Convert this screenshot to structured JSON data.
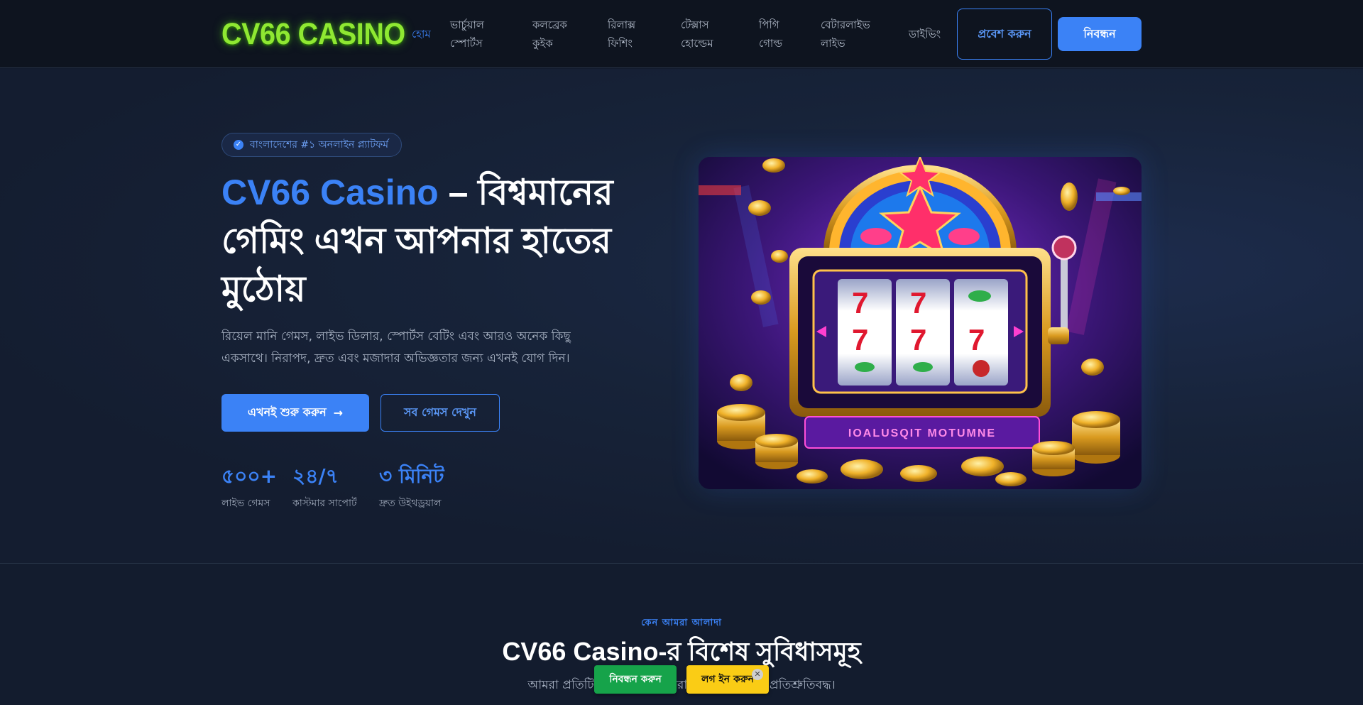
{
  "header": {
    "logo": "CV66 CASINO",
    "nav": [
      {
        "label": "হোম",
        "active": true
      },
      {
        "label": "ভার্চুয়াল\nস্পোর্টস"
      },
      {
        "label": "কলব্রেক\nকুইক"
      },
      {
        "label": "রিলাক্স\nফিশিং"
      },
      {
        "label": "টেক্সাস\nহোল্ডেম"
      },
      {
        "label": "পিগি\nগোল্ড"
      },
      {
        "label": "বেটারলাইভ\nলাইভ"
      },
      {
        "label": "ডাইভিং"
      }
    ],
    "login_label": "প্রবেশ করুন",
    "register_label": "নিবন্ধন"
  },
  "hero": {
    "badge": "বাংলাদেশের #১ অনলাইন প্ল্যাটফর্ম",
    "title_brand": "CV66 Casino",
    "title_rest": " – বিশ্বমানের গেমিং এখন আপনার হাতের মুঠোয়",
    "description": "রিয়েল মানি গেমস, লাইভ ডিলার, স্পোর্টস বেটিং এবং আরও অনেক কিছু একসাথে। নিরাপদ, দ্রুত এবং মজাদার অভিজ্ঞতার জন্য এখনই যোগ দিন।",
    "cta_primary": "এখনই শুরু করুন",
    "cta_secondary": "সব গেমস দেখুন",
    "stats": [
      {
        "value": "৫০০+",
        "label": "লাইভ গেমস"
      },
      {
        "value": "২৪/৭",
        "label": "কাস্টমার সাপোর্ট"
      },
      {
        "value": "৩ মিনিট",
        "label": "দ্রুত উইথড্রয়াল"
      }
    ],
    "image_text": "IOALUSQIT MOTUMNE"
  },
  "features": {
    "kicker": "কেন আমরা আলাদা",
    "title": "CV66 Casino-র বিশেষ সুবিধাসমূহ",
    "subtitle": "আমরা প্রতিটি খেলোয়াড়কে সেরা অভিজ্ঞতা দিতে প্রতিশ্রুতিবদ্ধ।"
  },
  "sticky": {
    "register": "নিবন্ধন করুন",
    "login": "লগ ইন করুন",
    "close": "✕"
  },
  "colors": {
    "accent": "#3b82f6",
    "header_bg": "#0e141f",
    "page_bg": "#131c2e",
    "logo_green": "#8fe832",
    "sticky_green": "#16a34a",
    "sticky_yellow": "#facc15"
  },
  "icons": {
    "badge": "verified-check-icon",
    "cta_arrow": "arrow-right-icon",
    "sticky_close": "close-icon"
  }
}
